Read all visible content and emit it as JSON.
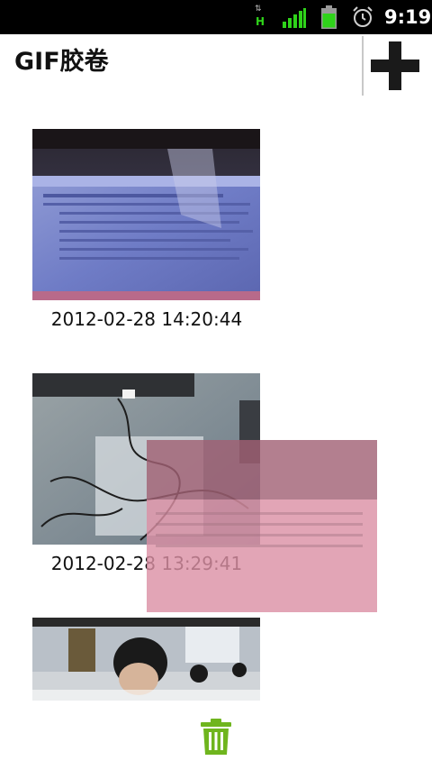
{
  "status_bar": {
    "network_type": "H",
    "network_icon": "hspa-data-icon",
    "signal_icon": "signal-bars-icon",
    "battery_icon": "battery-icon",
    "alarm_icon": "alarm-clock-icon",
    "time": "9:19"
  },
  "title_bar": {
    "title": "GIF胶卷",
    "add_icon": "plus-icon"
  },
  "gallery": {
    "items": [
      {
        "caption": "2012-02-28 14:20:44",
        "thumbnail": "monitor-screenshot-photo"
      },
      {
        "caption": "2012-02-28 13:29:41",
        "thumbnail": "desk-cables-photo"
      },
      {
        "caption": "",
        "thumbnail": "office-people-photo"
      }
    ]
  },
  "drag_preview": {
    "thumbnail": "monitor-screenshot-photo"
  },
  "bottom": {
    "delete_icon": "trash-icon"
  },
  "colors": {
    "accent_green": "#6fb51e",
    "status_green": "#2fd31a",
    "overlay_pink": "#d98aa0"
  }
}
